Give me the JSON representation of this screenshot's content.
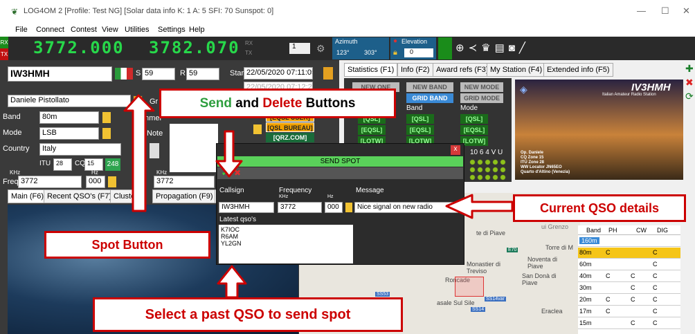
{
  "window": {
    "title": "LOG4OM 2 [Profile: Test NG] [Solar data info K: 1 A: 5 SFI: 70 Sunspot: 0]"
  },
  "menu": [
    "File",
    "Connect",
    "Contest",
    "View",
    "Utilities",
    "Settings",
    "Help"
  ],
  "toolbar": {
    "rx": "RX",
    "tx": "TX",
    "freq_rx": "3772.000",
    "freq_tx": "3782.070",
    "rx2": "RX",
    "tx2": "TX",
    "radio_num": "1",
    "azimuth_label": "Azimuth",
    "az1": "123°",
    "az2": "303°",
    "elevation_label": "Elevation",
    "elevation_value": "0"
  },
  "qso": {
    "callsign": "IW3HMH",
    "rst_s": "59",
    "rst_r": "59",
    "start_label": "Start",
    "start": "22/05/2020 07:11:05",
    "end_label": "End",
    "end": "22/05/2020 07:12:28",
    "name": "Daniele Pistollato",
    "band_label": "Band",
    "band": "80m",
    "mode_label": "Mode",
    "mode": "LSB",
    "country_label": "Country",
    "country": "Italy",
    "itu_label": "ITU",
    "itu": "28",
    "cq_label": "CQ",
    "cq": "15",
    "dxcc": "248",
    "freq_label": "Freq",
    "khz": "KHz",
    "hz": "Hz",
    "freq": "3772",
    "freq_hz": "000",
    "freq2": "3772",
    "grid_label": "Gr",
    "comment_label": "Commer",
    "note_label": "Note"
  },
  "qsl": {
    "eqsl_user": "[EQSL USER]",
    "qsl_bureau": "[QSL BUREAU]",
    "qrz": "[QRZ.COM]"
  },
  "bottom_tabs": [
    "Main (F6)",
    "Recent QSO's (F7)",
    "Cluster",
    "Propagation (F9)",
    "W"
  ],
  "right_tabs": [
    "Statistics (F1)",
    "Info (F2)",
    "Award refs (F3)",
    "My Station (F4)",
    "Extended info (F5)"
  ],
  "stats": {
    "new_one": "NEW ONE",
    "new_band": "NEW BAND",
    "new_mode": "NEW MODE",
    "grid_band": "GRID BAND",
    "grid_mode": "GRID MODE",
    "band": "Band",
    "mode": "Mode",
    "qsl": "[QSL]",
    "eqsl": "[EQSL]",
    "lotw": "[LOTW]",
    "sat": "10  6  4  V  U"
  },
  "station_card": {
    "call": "IV3HMH",
    "subtitle": "Italian Amateur Radio Station",
    "info": [
      "Op. Daniele",
      "CQ Zone 15",
      "ITU Zone 28",
      "WW Locator JN65EO",
      "Quarto d'Altino (Venezia)"
    ]
  },
  "spot": {
    "title": "SEND SPOT",
    "callsign_label": "Callsign",
    "frequency_label": "Frequency",
    "khz": "KHz",
    "hz": "Hz",
    "message_label": "Message",
    "callsign": "IW3HMH",
    "freq": "3772",
    "freq_hz": "000",
    "message": "Nice signal on new radio",
    "latest_label": "Latest qso's",
    "latest": [
      "K7IOC",
      "R6AM",
      "YL2GN"
    ],
    "close": "x"
  },
  "map": {
    "places": [
      "te di Piave",
      "Torre di M",
      "Noventa di Piave",
      "Monastier di Treviso",
      "San Donà di Piave",
      "Roncade",
      "asale Sul Sile",
      "Eraclea",
      "ui Grenzo"
    ],
    "roads": [
      "E70",
      "SS53",
      "SS14var",
      "SS14",
      "E70"
    ]
  },
  "bands": {
    "headers": [
      "Band",
      "PH",
      "CW",
      "DIG"
    ],
    "rows": [
      [
        "160m",
        "",
        "",
        ""
      ],
      [
        "80m",
        "C",
        "",
        "C"
      ],
      [
        "60m",
        "",
        "",
        "C"
      ],
      [
        "40m",
        "C",
        "C",
        "C"
      ],
      [
        "30m",
        "",
        "C",
        "C"
      ],
      [
        "20m",
        "C",
        "C",
        "C"
      ],
      [
        "17m",
        "C",
        "",
        "C"
      ],
      [
        "15m",
        "",
        "C",
        "C"
      ]
    ]
  },
  "callouts": {
    "send_word": "Send",
    "and_delete": "and",
    "delete_word": "Delete",
    "buttons": "Buttons",
    "spot_button": "Spot Button",
    "current_qso": "Current QSO details",
    "select_past": "Select a past QSO to send spot"
  },
  "colors": {
    "led": "#27d84a",
    "callout": "#cc0000",
    "send_green": "#2e9e3e",
    "green_header": "#5ad15a"
  }
}
